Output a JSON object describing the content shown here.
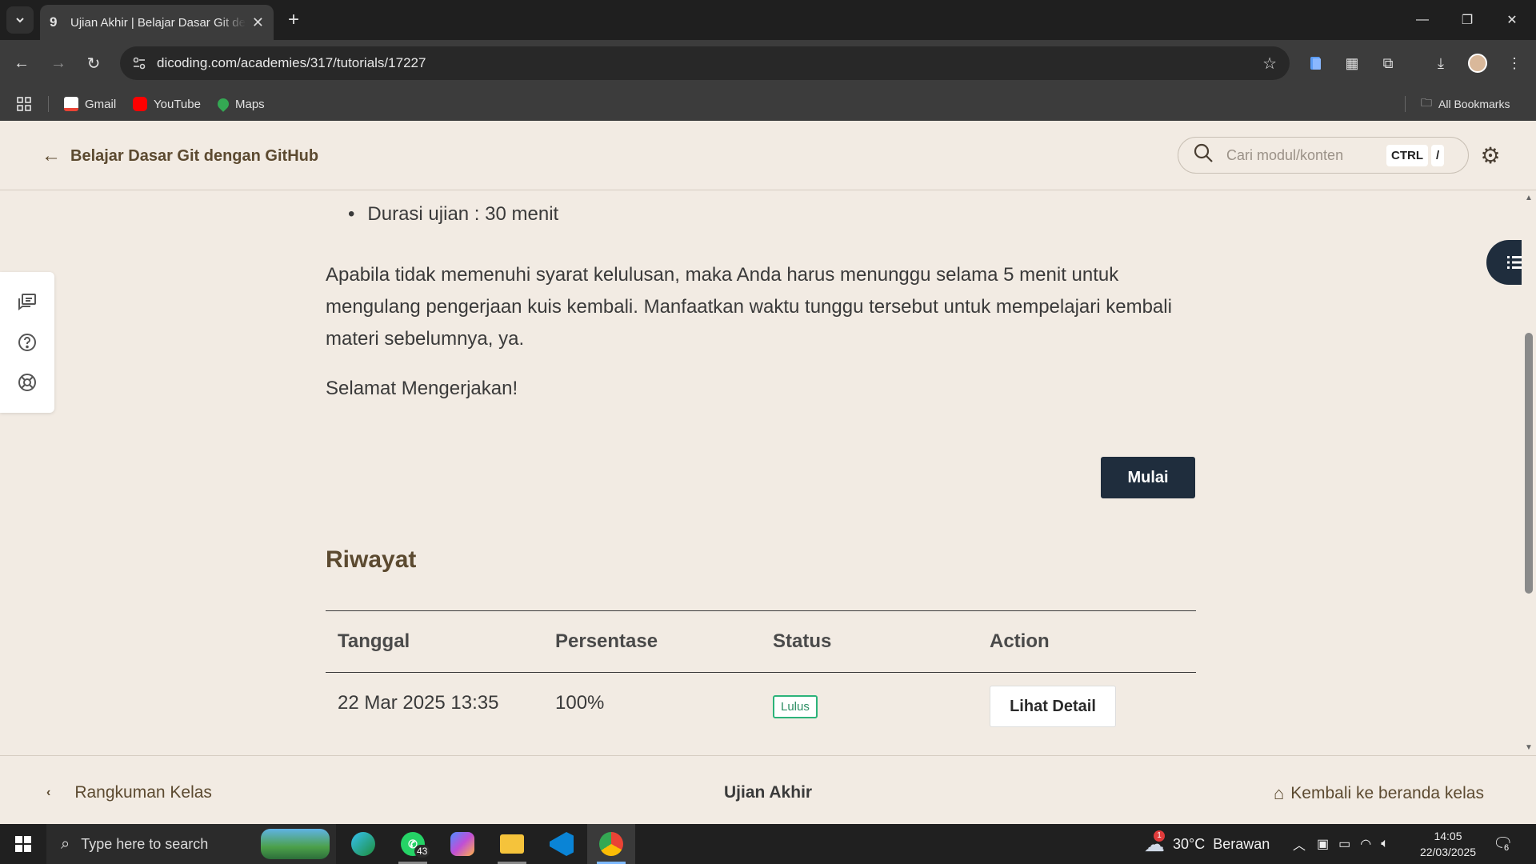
{
  "browser": {
    "tab_title": "Ujian Akhir | Belajar Dasar Git dengan GitHub",
    "url": "dicoding.com/academies/317/tutorials/17227",
    "bookmarks": [
      {
        "label": "Gmail",
        "icon": "gmail-icon",
        "color": "#ea4335"
      },
      {
        "label": "YouTube",
        "icon": "youtube-icon",
        "color": "#ff0000"
      },
      {
        "label": "Maps",
        "icon": "maps-icon",
        "color": "#34a853"
      }
    ],
    "all_bookmarks_label": "All Bookmarks"
  },
  "header": {
    "course_title": "Belajar Dasar Git dengan GitHub",
    "search_placeholder": "Cari modul/konten",
    "shortcut_key1": "CTRL",
    "shortcut_key2": "/"
  },
  "content": {
    "bullet": "Durasi ujian : 30 menit",
    "paragraph": "Apabila tidak memenuhi syarat kelulusan, maka Anda harus menunggu selama 5 menit untuk mengulang pengerjaan kuis kembali. Manfaatkan waktu tunggu tersebut untuk mempelajari kembali materi sebelumnya, ya.",
    "closing": "Selamat Mengerjakan!",
    "start_button": "Mulai",
    "history_title": "Riwayat",
    "table": {
      "headers": [
        "Tanggal",
        "Persentase",
        "Status",
        "Action"
      ],
      "rows": [
        {
          "date": "22 Mar 2025 13:35",
          "percent": "100%",
          "status": "Lulus",
          "action": "Lihat Detail"
        }
      ]
    }
  },
  "footer": {
    "prev": "Rangkuman Kelas",
    "current": "Ujian Akhir",
    "home": "Kembali ke beranda kelas"
  },
  "taskbar": {
    "search_placeholder": "Type here to search",
    "whatsapp_badge": "43",
    "weather_badge": "1",
    "weather": "30°C  Berawan",
    "time": "14:05",
    "date": "22/03/2025",
    "notifications": "6"
  },
  "colors": {
    "page_bg": "#f2ebe3",
    "primary_dark": "#1f2d3d",
    "heading_brown": "#5c4a30",
    "success_green": "#2cb37a"
  }
}
